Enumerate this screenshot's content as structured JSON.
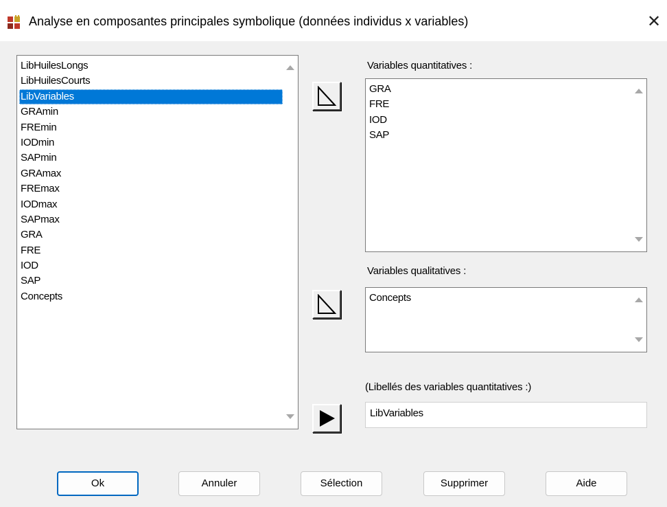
{
  "window": {
    "title": "Analyse en composantes principales symbolique (données individus x variables)",
    "close_glyph": "✕"
  },
  "available_list": {
    "items": [
      "LibHuilesLongs",
      "LibHuilesCourts",
      "LibVariables",
      "GRAmin",
      "FREmin",
      "IODmin",
      "SAPmin",
      "GRAmax",
      "FREmax",
      "IODmax",
      "SAPmax",
      "GRA",
      "FRE",
      "IOD",
      "SAP",
      "Concepts"
    ],
    "selected": "LibVariables"
  },
  "quantitative": {
    "label": "Variables quantitatives :",
    "items": [
      "GRA",
      "FRE",
      "IOD",
      "SAP"
    ]
  },
  "qualitative": {
    "label": "Variables qualitatives :",
    "items": [
      "Concepts"
    ]
  },
  "labels_field": {
    "label": "(Libellés des variables quantitatives :)",
    "value": "LibVariables"
  },
  "buttons": {
    "ok": "Ok",
    "cancel": "Annuler",
    "selection": "Sélection",
    "delete": "Supprimer",
    "help": "Aide"
  },
  "icons": {
    "app": "grid-app-icon",
    "close": "close-icon",
    "move_outline": "outline-triangle-arrow-icon",
    "move_filled": "filled-triangle-arrow-icon",
    "scroll_up": "scroll-up-arrow-icon",
    "scroll_down": "scroll-down-arrow-icon"
  },
  "colors": {
    "selection": "#0078d7",
    "default_button_border": "#0067c0",
    "icon_red": "#c0392b",
    "icon_gold": "#c9a227"
  }
}
